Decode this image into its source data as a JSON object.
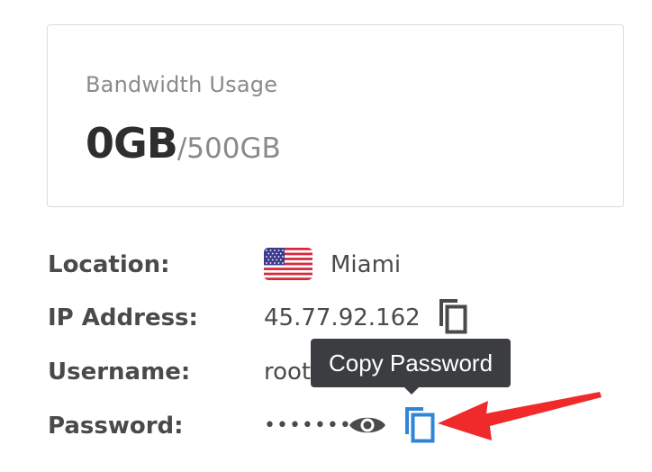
{
  "bandwidth": {
    "label": "Bandwidth Usage",
    "used": "0GB",
    "limit": "/500GB"
  },
  "details": {
    "location": {
      "label": "Location:",
      "value": "Miami",
      "flag_icon": "us-flag-icon"
    },
    "ip": {
      "label": "IP Address:",
      "value": "45.77.92.162",
      "copy_icon": "copy-icon"
    },
    "username": {
      "label": "Username:",
      "value": "root"
    },
    "password": {
      "label": "Password:",
      "value": "•••••••",
      "show_icon": "eye-icon",
      "copy_icon": "copy-icon"
    }
  },
  "tooltip": {
    "text": "Copy Password"
  },
  "colors": {
    "accent": "#2f86d6",
    "icon_gray": "#4a4a4a",
    "tooltip_bg": "#3b3d40",
    "annotation_red": "#f02a2a"
  }
}
